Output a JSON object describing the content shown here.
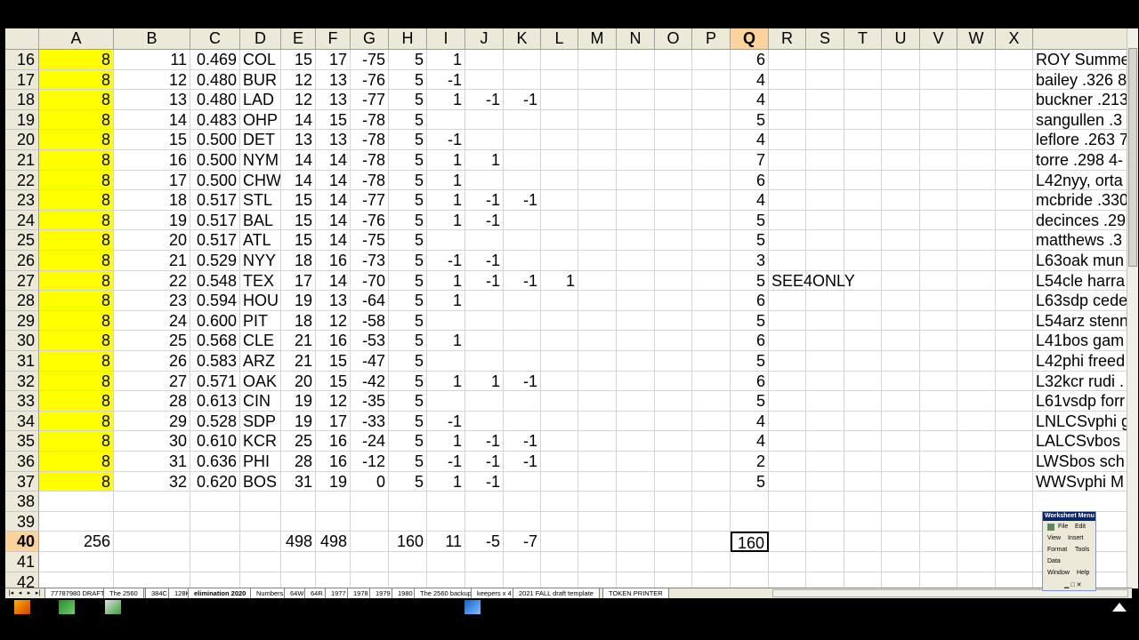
{
  "columns": [
    "A",
    "B",
    "C",
    "D",
    "E",
    "F",
    "G",
    "H",
    "I",
    "J",
    "K",
    "L",
    "M",
    "N",
    "O",
    "P",
    "Q",
    "R",
    "S",
    "T",
    "U",
    "V",
    "W",
    "X",
    ""
  ],
  "selected_column": "Q",
  "selected_row": "40",
  "rows": [
    {
      "n": "16",
      "A": "8",
      "B": "11",
      "C": "0.469",
      "D": "COL",
      "E": "15",
      "F": "17",
      "G": "-75",
      "H": "5",
      "I": "1",
      "Q": "6",
      "Y": "ROY Summe"
    },
    {
      "n": "17",
      "A": "8",
      "B": "12",
      "C": "0.480",
      "D": "BUR",
      "E": "12",
      "F": "13",
      "G": "-76",
      "H": "5",
      "I": "-1",
      "Q": "4",
      "Y": "bailey .326 8"
    },
    {
      "n": "18",
      "A": "8",
      "B": "13",
      "C": "0.480",
      "D": "LAD",
      "E": "12",
      "F": "13",
      "G": "-77",
      "H": "5",
      "I": "1",
      "J": "-1",
      "K": "-1",
      "Q": "4",
      "Y": "buckner .213"
    },
    {
      "n": "19",
      "A": "8",
      "B": "14",
      "C": "0.483",
      "D": "OHP",
      "E": "14",
      "F": "15",
      "G": "-78",
      "H": "5",
      "Q": "5",
      "Y": "sangullen .3"
    },
    {
      "n": "20",
      "A": "8",
      "B": "15",
      "C": "0.500",
      "D": "DET",
      "E": "13",
      "F": "13",
      "G": "-78",
      "H": "5",
      "I": "-1",
      "Q": "4",
      "Y": "leflore .263 7"
    },
    {
      "n": "21",
      "A": "8",
      "B": "16",
      "C": "0.500",
      "D": "NYM",
      "E": "14",
      "F": "14",
      "G": "-78",
      "H": "5",
      "I": "1",
      "J": "1",
      "Q": "7",
      "Y": "torre .298 4-"
    },
    {
      "n": "22",
      "A": "8",
      "B": "17",
      "C": "0.500",
      "D": "CHW",
      "E": "14",
      "F": "14",
      "G": "-78",
      "H": "5",
      "I": "1",
      "Q": "6",
      "Y": "L42nyy, orta"
    },
    {
      "n": "23",
      "A": "8",
      "B": "18",
      "C": "0.517",
      "D": "STL",
      "E": "15",
      "F": "14",
      "G": "-77",
      "H": "5",
      "I": "1",
      "J": "-1",
      "K": "-1",
      "Q": "4",
      "Y": "mcbride .330"
    },
    {
      "n": "24",
      "A": "8",
      "B": "19",
      "C": "0.517",
      "D": "BAL",
      "E": "15",
      "F": "14",
      "G": "-76",
      "H": "5",
      "I": "1",
      "J": "-1",
      "Q": "5",
      "Y": "decinces .29"
    },
    {
      "n": "25",
      "A": "8",
      "B": "20",
      "C": "0.517",
      "D": "ATL",
      "E": "15",
      "F": "14",
      "G": "-75",
      "H": "5",
      "Q": "5",
      "Y": "matthews .3"
    },
    {
      "n": "26",
      "A": "8",
      "B": "21",
      "C": "0.529",
      "D": "NYY",
      "E": "18",
      "F": "16",
      "G": "-73",
      "H": "5",
      "I": "-1",
      "J": "-1",
      "Q": "3",
      "Y": "L63oak mun"
    },
    {
      "n": "27",
      "A": "8",
      "B": "22",
      "C": "0.548",
      "D": "TEX",
      "E": "17",
      "F": "14",
      "G": "-70",
      "H": "5",
      "I": "1",
      "J": "-1",
      "K": "-1",
      "L": "1",
      "Q": "5",
      "R": "SEE4ONLY",
      "Y": "L54cle harra"
    },
    {
      "n": "28",
      "A": "8",
      "B": "23",
      "C": "0.594",
      "D": "HOU",
      "E": "19",
      "F": "13",
      "G": "-64",
      "H": "5",
      "I": "1",
      "Q": "6",
      "Y": "L63sdp cede"
    },
    {
      "n": "29",
      "A": "8",
      "B": "24",
      "C": "0.600",
      "D": "PIT",
      "E": "18",
      "F": "12",
      "G": "-58",
      "H": "5",
      "Q": "5",
      "Y": "L54arz stenn"
    },
    {
      "n": "30",
      "A": "8",
      "B": "25",
      "C": "0.568",
      "D": "CLE",
      "E": "21",
      "F": "16",
      "G": "-53",
      "H": "5",
      "I": "1",
      "Q": "6",
      "Y": "L41bos gam"
    },
    {
      "n": "31",
      "A": "8",
      "B": "26",
      "C": "0.583",
      "D": "ARZ",
      "E": "21",
      "F": "15",
      "G": "-47",
      "H": "5",
      "Q": "5",
      "Y": "L42phi freed"
    },
    {
      "n": "32",
      "A": "8",
      "B": "27",
      "C": "0.571",
      "D": "OAK",
      "E": "20",
      "F": "15",
      "G": "-42",
      "H": "5",
      "I": "1",
      "J": "1",
      "K": "-1",
      "Q": "6",
      "Y": "L32kcr rudi ."
    },
    {
      "n": "33",
      "A": "8",
      "B": "28",
      "C": "0.613",
      "D": "CIN",
      "E": "19",
      "F": "12",
      "G": "-35",
      "H": "5",
      "Q": "5",
      "Y": "L61vsdp forr"
    },
    {
      "n": "34",
      "A": "8",
      "B": "29",
      "C": "0.528",
      "D": "SDP",
      "E": "19",
      "F": "17",
      "G": "-33",
      "H": "5",
      "I": "-1",
      "Q": "4",
      "Y": "LNLCSvphi g"
    },
    {
      "n": "35",
      "A": "8",
      "B": "30",
      "C": "0.610",
      "D": "KCR",
      "E": "25",
      "F": "16",
      "G": "-24",
      "H": "5",
      "I": "1",
      "J": "-1",
      "K": "-1",
      "Q": "4",
      "Y": "LALCSvbos"
    },
    {
      "n": "36",
      "A": "8",
      "B": "31",
      "C": "0.636",
      "D": "PHI",
      "E": "28",
      "F": "16",
      "G": "-12",
      "H": "5",
      "I": "-1",
      "J": "-1",
      "K": "-1",
      "Q": "2",
      "Y": "LWSbos sch"
    },
    {
      "n": "37",
      "A": "8",
      "B": "32",
      "C": "0.620",
      "D": "BOS",
      "E": "31",
      "F": "19",
      "G": "0",
      "H": "5",
      "I": "1",
      "J": "-1",
      "Q": "5",
      "Y": "WWSvphi M"
    },
    {
      "n": "38"
    },
    {
      "n": "39"
    },
    {
      "n": "40",
      "A": "256",
      "E": "498",
      "F": "498",
      "H": "160",
      "I": "11",
      "J": "-5",
      "K": "-7",
      "Q": "160"
    },
    {
      "n": "41"
    },
    {
      "n": "42"
    }
  ],
  "sheet_tabs": [
    "77787980 DRAFT",
    "The 2560",
    "384C",
    "128K",
    "elimination 2020",
    "Numbers",
    "64W",
    "64R",
    "1977",
    "1978",
    "1979",
    "1980",
    "The 2560 backup",
    "keepers x 4",
    "2021 FALL draft template",
    "TOKEN PRINTER"
  ],
  "active_tab": "elimination 2020",
  "worksheet_menu": {
    "title": "Worksheet Menu",
    "items": [
      "File",
      "Edit",
      "View",
      "Insert",
      "Format",
      "Tools",
      "Data",
      "Window",
      "Help"
    ]
  }
}
